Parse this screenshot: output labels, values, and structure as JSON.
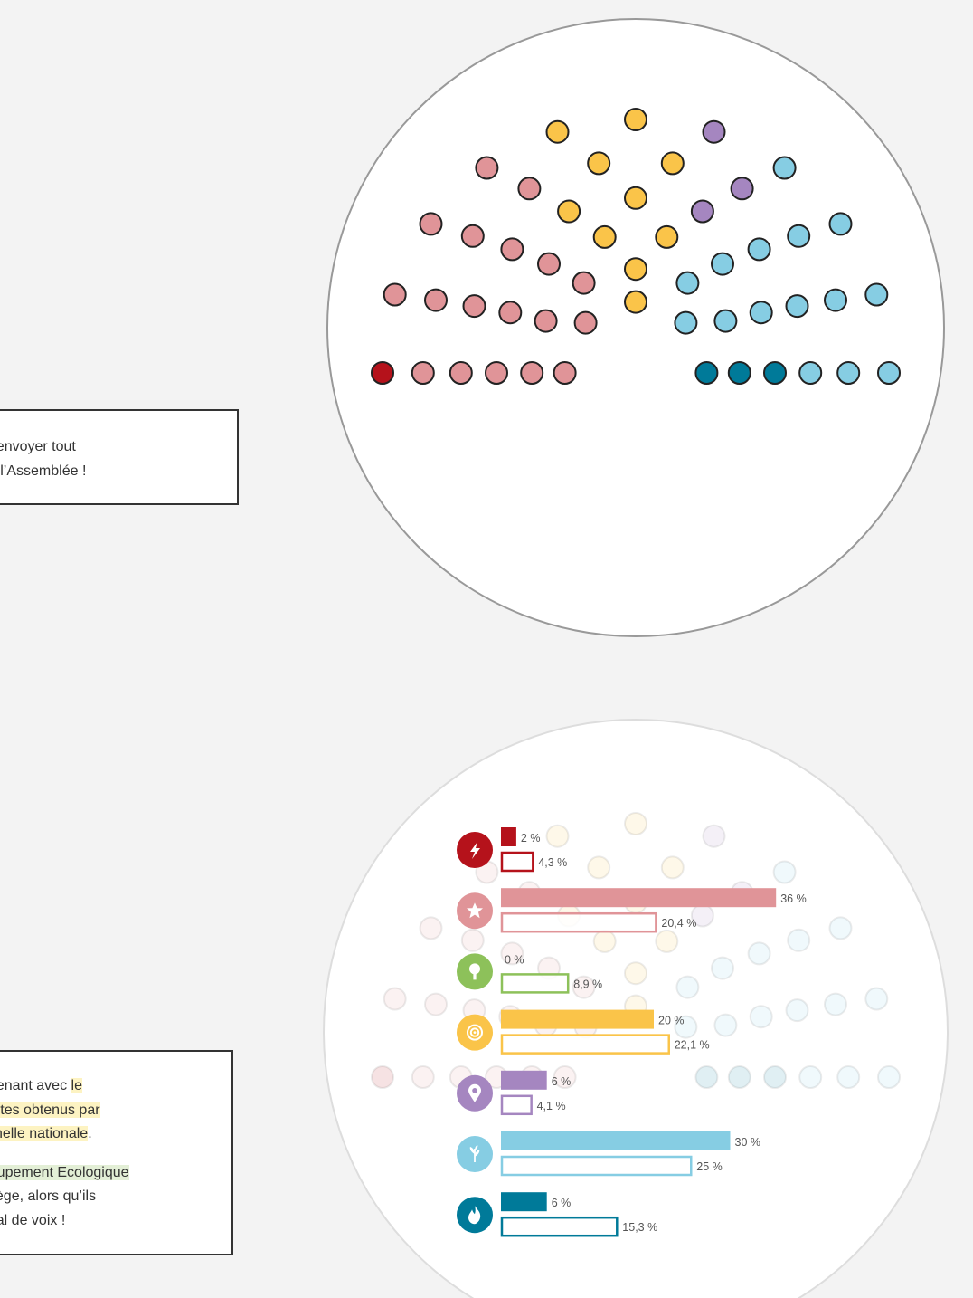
{
  "text_card_top": {
    "lines": [
      "u’à envoyer tout",
      "le à l’Assemblée !"
    ]
  },
  "text_card_bottom": {
    "lines": [
      {
        "before": "aintenant avec ",
        "highlight": "le",
        "after": ""
      },
      {
        "before": "",
        "highlight": "e votes obtenus par",
        "after": ""
      },
      {
        "before": "",
        "highlight": "l’échelle nationale",
        "after": "."
      }
    ],
    "lines2": [
      {
        "before": "",
        "highlight_green": "Groupement Ecologique",
        "after": ""
      },
      {
        "before": "n siège, alors qu’ils",
        "highlight_green": "",
        "after": ""
      },
      {
        "before": "s mal de voix !",
        "highlight_green": "",
        "after": ""
      }
    ]
  },
  "colors": {
    "dark_red": "#b5121b",
    "pink": "#e09498",
    "green": "#8dc15a",
    "yellow": "#fac449",
    "purple": "#a586c0",
    "light_blue": "#86cde3",
    "teal": "#007a99",
    "circle_border": "#999999"
  },
  "chart_data": [
    {
      "type": "scatter",
      "description": "hemicycle",
      "seats": 50,
      "series": [
        {
          "party": "lightning",
          "color": "#b5121b",
          "seats": 1
        },
        {
          "party": "star",
          "color": "#e09498",
          "seats": 18
        },
        {
          "party": "tree",
          "color": "#8dc15a",
          "seats": 0
        },
        {
          "party": "target",
          "color": "#fac449",
          "seats": 10
        },
        {
          "party": "pin",
          "color": "#a586c0",
          "seats": 3
        },
        {
          "party": "plant",
          "color": "#86cde3",
          "seats": 15
        },
        {
          "party": "flame",
          "color": "#007a99",
          "seats": 3
        }
      ]
    },
    {
      "type": "bar",
      "orientation": "horizontal",
      "categories": [
        "lightning",
        "star",
        "tree",
        "target",
        "pin",
        "plant",
        "flame"
      ],
      "icons": [
        "lightning-icon",
        "star-icon",
        "tree-icon",
        "target-icon",
        "pin-icon",
        "plant-icon",
        "flame-icon"
      ],
      "colors": [
        "#b5121b",
        "#e09498",
        "#8dc15a",
        "#fac449",
        "#a586c0",
        "#86cde3",
        "#007a99"
      ],
      "series": [
        {
          "values": [
            2,
            36,
            0,
            20,
            6,
            30,
            6
          ],
          "labels": [
            "2 %",
            "36 %",
            "0 %",
            "20 %",
            "6 %",
            "30 %",
            "6 %"
          ],
          "style": "filled"
        },
        {
          "values": [
            4.3,
            20.4,
            8.9,
            22.1,
            4.1,
            25,
            15.3
          ],
          "labels": [
            "4,3 %",
            "20,4 %",
            "8,9 %",
            "22,1 %",
            "4,1 %",
            "25 %",
            "15,3 %"
          ],
          "style": "outline"
        }
      ],
      "unit": "%"
    }
  ]
}
